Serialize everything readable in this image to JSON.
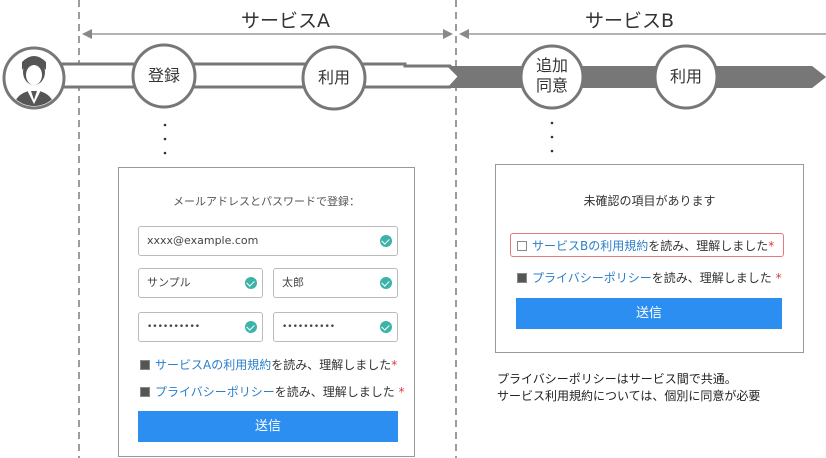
{
  "services": {
    "a_label": "サービスA",
    "b_label": "サービスB"
  },
  "flow": {
    "register": "登録",
    "use_a": "利用",
    "consent_line1": "追加",
    "consent_line2": "同意",
    "use_b": "利用"
  },
  "form_a": {
    "title": "メールアドレスとパスワードで登録：",
    "email": "xxxx@example.com",
    "last_name": "サンプル",
    "first_name": "太郎",
    "password": "••••••••••",
    "password_confirm": "••••••••••",
    "terms_link": "サービスAの利用規約",
    "terms_text": "を読み、理解しました",
    "privacy_link": "プライバシーポリシー",
    "privacy_text": "を読み、理解しました",
    "required_mark": "*",
    "submit": "送信"
  },
  "form_b": {
    "title": "未確認の項目があります",
    "terms_link": "サービスBの利用規約",
    "terms_text": "を読み、理解しました",
    "privacy_link": "プライバシーポリシー",
    "privacy_text": "を読み、理解しました",
    "required_mark": "*",
    "submit": "送信"
  },
  "note": {
    "line1": "プライバシーポリシーはサービス間で共通。",
    "line2": "サービス利用規約については、個別に同意が必要"
  },
  "colors": {
    "accent_blue": "#2b8ef0",
    "link_blue": "#2c7fc9",
    "check_teal": "#3bb3a8",
    "error_red": "#e0393e",
    "arrow_gray": "#777777"
  }
}
